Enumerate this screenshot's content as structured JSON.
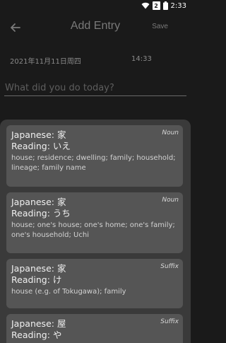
{
  "status_bar": {
    "time": "2:33",
    "sim": "2"
  },
  "app_bar": {
    "title": "Add Entry",
    "save_label": "Save"
  },
  "entry": {
    "date": "2021年11月11日周四",
    "time": "14:33",
    "placeholder": "What did you do today?"
  },
  "results": [
    {
      "japanese": "Japanese: 家",
      "reading": "Reading: いえ",
      "pos": "Noun",
      "meaning": "house; residence; dwelling; family; household; lineage; family name"
    },
    {
      "japanese": "Japanese: 家",
      "reading": "Reading: うち",
      "pos": "Noun",
      "meaning": "house; one's house; one's home; one's family; one's household; Uchi"
    },
    {
      "japanese": "Japanese: 家",
      "reading": "Reading: け",
      "pos": "Suffix",
      "meaning": "house (e.g. of Tokugawa); family"
    },
    {
      "japanese": "Japanese: 屋",
      "reading": "Reading: や",
      "pos": "Suffix",
      "meaning": ""
    }
  ],
  "colors": {
    "background": "#1a1a1a",
    "sheet": "#3a3a3a",
    "card": "#555555"
  }
}
